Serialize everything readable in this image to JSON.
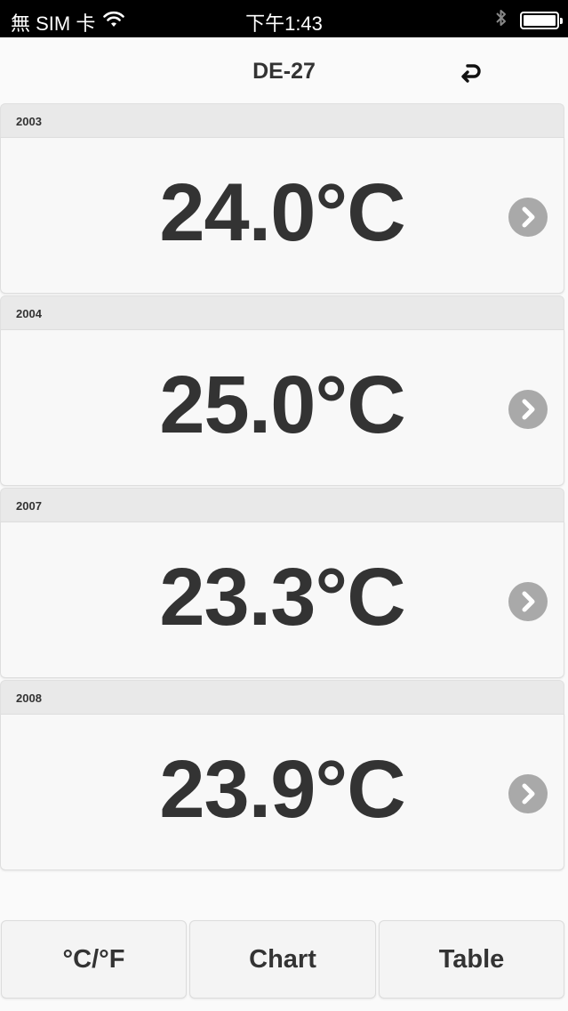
{
  "status_bar": {
    "carrier": "無 SIM 卡",
    "time": "下午1:43"
  },
  "nav": {
    "title": "DE-27"
  },
  "sections": [
    {
      "header": "2003",
      "value": "24.0°C"
    },
    {
      "header": "2004",
      "value": "25.0°C"
    },
    {
      "header": "2007",
      "value": "23.3°C"
    },
    {
      "header": "2008",
      "value": "23.9°C"
    }
  ],
  "toolbar": {
    "unit_label": "°C/°F",
    "chart_label": "Chart",
    "table_label": "Table"
  },
  "colors": {
    "chevron": "#a9a9a9",
    "section_header_bg": "#e9e9e9",
    "cell_bg": "#f8f8f8"
  }
}
